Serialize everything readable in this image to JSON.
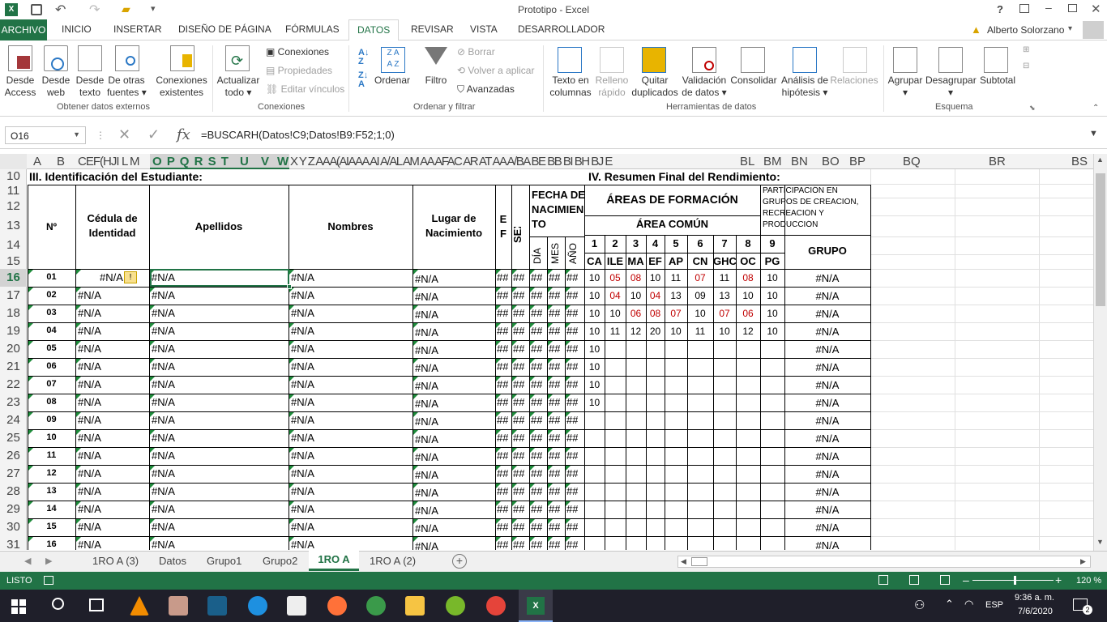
{
  "app": {
    "title": "Prototipo - Excel",
    "user": "Alberto Solorzano",
    "help": "?"
  },
  "tabs": [
    "ARCHIVO",
    "INICIO",
    "INSERTAR",
    "DISEÑO DE PÁGINA",
    "FÓRMULAS",
    "DATOS",
    "REVISAR",
    "VISTA",
    "DESARROLLADOR"
  ],
  "ribbon": {
    "g1": {
      "name": "Obtener datos externos",
      "b1": "Desde",
      "b1b": "Access",
      "b2": "Desde",
      "b2b": "web",
      "b3": "Desde",
      "b3b": "texto",
      "b4": "De otras",
      "b4b": "fuentes ▾",
      "b5": "Conexiones",
      "b5b": "existentes"
    },
    "g2": {
      "name": "Conexiones",
      "b1": "Actualizar",
      "b1b": "todo ▾",
      "s1": "Conexiones",
      "s2": "Propiedades",
      "s3": "Editar vínculos"
    },
    "g3": {
      "name": "Ordenar y filtrar",
      "b1": "Ordenar",
      "b2": "Filtro",
      "s1": "Borrar",
      "s2": "Volver a aplicar",
      "s3": "Avanzadas"
    },
    "g4": {
      "name": "Herramientas de datos",
      "b1": "Texto en",
      "b1b": "columnas",
      "b2": "Relleno",
      "b2b": "rápido",
      "b3": "Quitar",
      "b3b": "duplicados",
      "b4": "Validación",
      "b4b": "de datos ▾",
      "b5": "Consolidar",
      "b6": "Análisis de",
      "b6b": "hipótesis ▾",
      "b7": "Relaciones"
    },
    "g5": {
      "name": "Esquema",
      "b1": "Agrupar",
      "b2": "Desagrupar",
      "b3": "Subtotal"
    }
  },
  "formula": {
    "namebox": "O16",
    "fx": "fx",
    "content": "=BUSCARH(Datos!C9;Datos!B9:F52;1;0)"
  },
  "columns": [
    "A",
    "B",
    "CEF(HJI",
    "L M",
    "O P Q R S T",
    "U",
    "V",
    "W",
    "X Y Z AAA(AIAAA AI A/AL AM AA AFAC AR AT AA A/BA BE BB BI BH BJ E",
    "BL",
    "BM",
    "BN",
    "BO",
    "BP",
    "BQ",
    "BR",
    "BS"
  ],
  "rows": [
    "10",
    "11",
    "12",
    "13",
    "14",
    "15",
    "16",
    "17",
    "18",
    "19",
    "20",
    "21",
    "22",
    "23",
    "24",
    "25",
    "26",
    "27",
    "28",
    "29",
    "30",
    "31"
  ],
  "sheet": {
    "title3": "III. Identificación del Estudiante:",
    "title4": "IV. Resumen Final del Rendimiento:",
    "h_num": "Nº",
    "h_ced": "Cédula de",
    "h_ced2": "Identidad",
    "h_ape": "Apellidos",
    "h_nom": "Nombres",
    "h_lug": "Lugar de",
    "h_lug2": "Nacimiento",
    "h_ef": "E",
    "h_ef2": "F",
    "h_sexo": "SEXO",
    "h_fecha": "FECHA DE",
    "h_fecha2": "NACIMIEN",
    "h_fecha3": "TO",
    "h_dia": "DÍA",
    "h_mes": "MES",
    "h_ano": "AÑO",
    "h_areas": "ÁREAS DE FORMACIÓN",
    "h_comun": "ÁREA COMÚN",
    "h_part1": "PARTICIPACIÓN EN",
    "h_part2": "GRUPOS DE CREACIÓN,",
    "h_part3": "RECREACIÓN Y",
    "h_part4": "PRODUCCIÓN",
    "h_grupo": "GRUPO",
    "area_nums": [
      "1",
      "2",
      "3",
      "4",
      "5",
      "6",
      "7",
      "8",
      "9"
    ],
    "area_codes": [
      "CA",
      "ILE",
      "MA",
      "EF",
      "AP",
      "CN",
      "GHC",
      "OC",
      "PG"
    ],
    "na": "#N/A",
    "hash": "##",
    "students": [
      "01",
      "02",
      "03",
      "04",
      "05",
      "06",
      "07",
      "08",
      "09",
      "10",
      "11",
      "12",
      "13",
      "14",
      "15",
      "16"
    ],
    "grades": [
      [
        "10",
        "05",
        "08",
        "10",
        "11",
        "07",
        "11",
        "08",
        "10"
      ],
      [
        "10",
        "04",
        "10",
        "04",
        "13",
        "09",
        "13",
        "10",
        "10"
      ],
      [
        "10",
        "10",
        "06",
        "08",
        "07",
        "10",
        "07",
        "06",
        "10"
      ],
      [
        "10",
        "11",
        "12",
        "20",
        "10",
        "11",
        "10",
        "12",
        "10"
      ],
      [
        "10"
      ],
      [
        "10"
      ],
      [
        "10"
      ],
      [
        "10"
      ]
    ]
  },
  "sheettabs": [
    "1RO A (3)",
    "Datos",
    "Grupo1",
    "Grupo2",
    "1RO A",
    "1RO A (2)"
  ],
  "status": {
    "ready": "LISTO",
    "zoom": "120 %"
  },
  "taskbar": {
    "time": "9:36 a. m.",
    "date": "7/6/2020",
    "lang": "ESP",
    "notif": "2"
  }
}
